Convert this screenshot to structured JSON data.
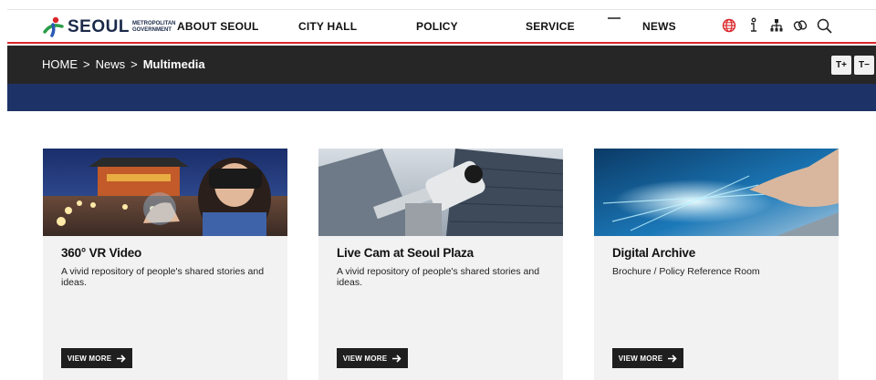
{
  "header": {
    "logo_text": "SEOUL",
    "logo_sub_1": "METROPOLITAN",
    "logo_sub_2": "GOVERNMENT",
    "nav": [
      "ABOUT SEOUL",
      "CITY HALL",
      "POLICY",
      "SERVICE",
      "NEWS"
    ],
    "tools": [
      "globe-icon",
      "info-icon",
      "sitemap-icon",
      "link-icon",
      "search-icon"
    ],
    "colors": {
      "accent": "#d9262a",
      "navy": "#1d3266"
    }
  },
  "breadcrumb": {
    "home": "HOME",
    "separator": ">",
    "section": "News",
    "current": "Multimedia",
    "font_increase": "T+",
    "font_decrease": "T−"
  },
  "cards": [
    {
      "title": "360° VR Video",
      "description": "A vivid repository of people's shared stories and ideas.",
      "button": "VIEW MORE"
    },
    {
      "title": "Live Cam at Seoul Plaza",
      "description": "A vivid repository of people's shared stories and ideas.",
      "button": "VIEW MORE"
    },
    {
      "title": "Digital Archive",
      "description": "Brochure / Policy Reference Room",
      "button": "VIEW MORE"
    }
  ]
}
